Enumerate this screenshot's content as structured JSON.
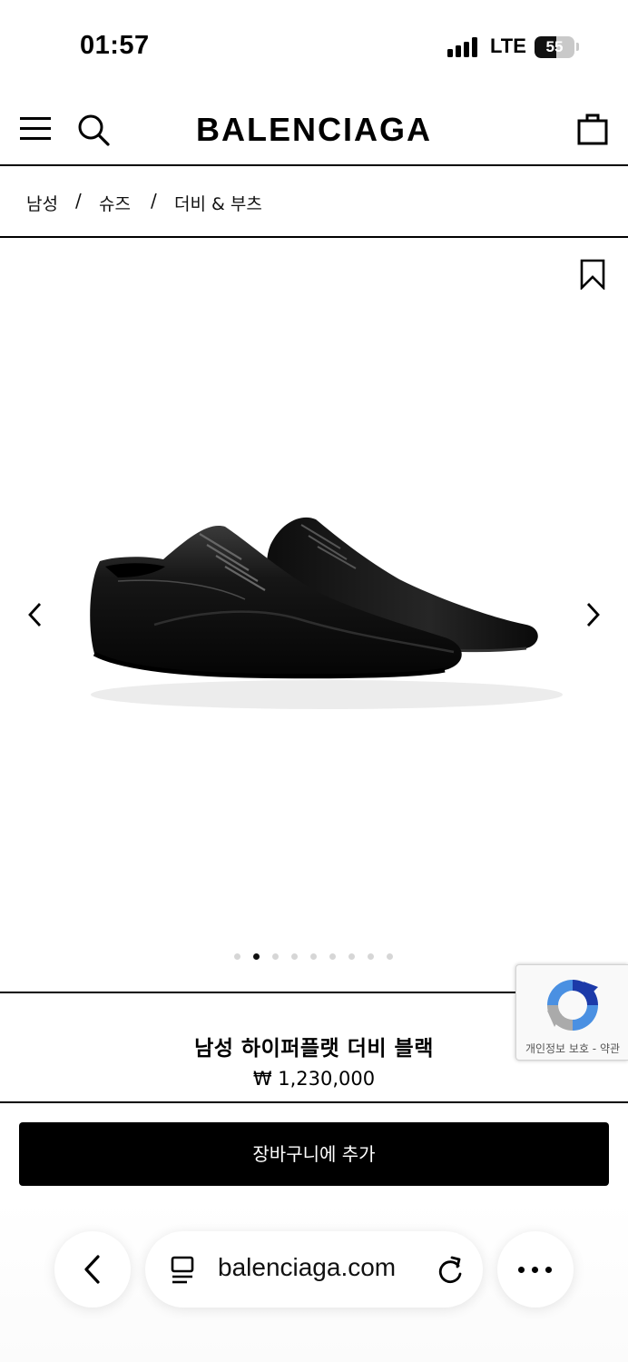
{
  "status_bar": {
    "time": "01:57",
    "network": "LTE",
    "battery": "55",
    "battery_level": 0.55
  },
  "header": {
    "logo": "BALENCIAGA",
    "icons": [
      "menu-icon",
      "search-icon",
      "shopping-bag-icon"
    ]
  },
  "breadcrumb": {
    "items": [
      "남성",
      "슈즈",
      "더비 & 부츠"
    ],
    "separator": "/"
  },
  "gallery": {
    "total_images": 9,
    "active_index": 1,
    "icons": [
      "bookmark-icon",
      "chevron-left-icon",
      "chevron-right-icon"
    ]
  },
  "product": {
    "name": "남성 하이퍼플랫 더비 블랙",
    "price": "₩ 1,230,000"
  },
  "recaptcha": {
    "label": "개인정보 보호 - 약관"
  },
  "actions": {
    "add_to_cart": "장바구니에 추가"
  },
  "browser": {
    "url": "balenciaga.com",
    "icons": [
      "back-icon",
      "tab-overview-icon",
      "reload-icon",
      "more-icon"
    ]
  },
  "colors": {
    "primary": "#000000",
    "background": "#ffffff",
    "dot_inactive": "#d6d6d6",
    "recaptcha_blue": "#4a90e2"
  }
}
